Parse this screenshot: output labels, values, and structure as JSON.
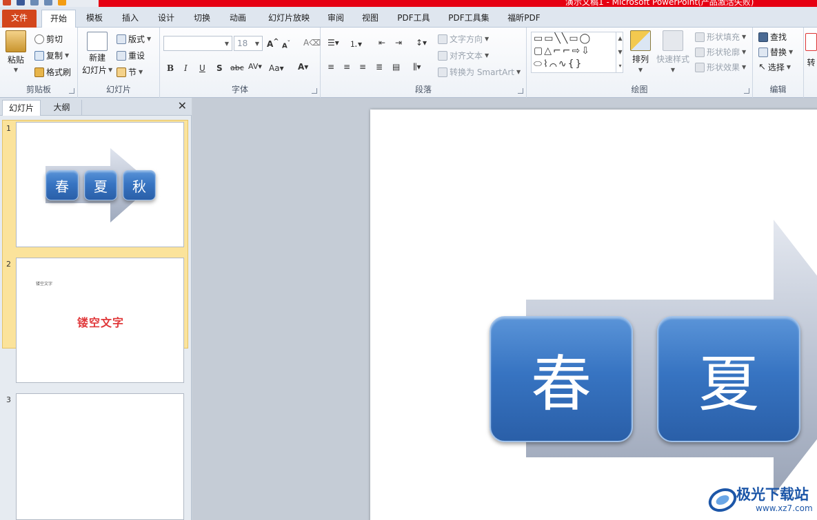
{
  "window": {
    "title": "演示文稿1 - Microsoft PowerPoint(产品激活失败)"
  },
  "tabs": [
    "文件",
    "开始",
    "模板",
    "插入",
    "设计",
    "切换",
    "动画",
    "幻灯片放映",
    "审阅",
    "视图",
    "PDF工具",
    "PDF工具集",
    "福昕PDF"
  ],
  "ribbon": {
    "clipboard": {
      "label": "剪贴板",
      "paste": "粘贴",
      "cut": "剪切",
      "copy": "复制",
      "format_painter": "格式刷"
    },
    "slides": {
      "label": "幻灯片",
      "new_slide_1": "新建",
      "new_slide_2": "幻灯片",
      "layout": "版式",
      "reset": "重设",
      "section": "节"
    },
    "font": {
      "label": "字体",
      "font_name": "",
      "font_size": "18"
    },
    "paragraph": {
      "label": "段落",
      "text_direction": "文字方向",
      "align_text": "对齐文本",
      "convert_smartart": "转换为 SmartArt"
    },
    "drawing": {
      "label": "绘图",
      "arrange": "排列",
      "quick_styles": "快速样式",
      "shape_fill": "形状填充",
      "shape_outline": "形状轮廓",
      "shape_effects": "形状效果"
    },
    "editing": {
      "label": "编辑",
      "find": "查找",
      "replace": "替换",
      "select": "选择"
    },
    "extra": {
      "label": "转"
    }
  },
  "left_pane": {
    "tabs": [
      "幻灯片",
      "大纲"
    ],
    "close": "✕",
    "slides": [
      {
        "number": "1",
        "boxes": [
          "春",
          "夏",
          "秋"
        ]
      },
      {
        "number": "2",
        "small_text": "镂空文字",
        "title": "镂空文字"
      },
      {
        "number": "3"
      }
    ]
  },
  "slide": {
    "boxes": [
      "春",
      "夏"
    ]
  },
  "watermark": {
    "text": "极光下载站",
    "url": "www.xz7.com"
  },
  "colors": {
    "file_tab": "#d3461c",
    "title_red": "#e60012",
    "box_blue": "#3774c2",
    "slide2_title": "#e0383a"
  }
}
